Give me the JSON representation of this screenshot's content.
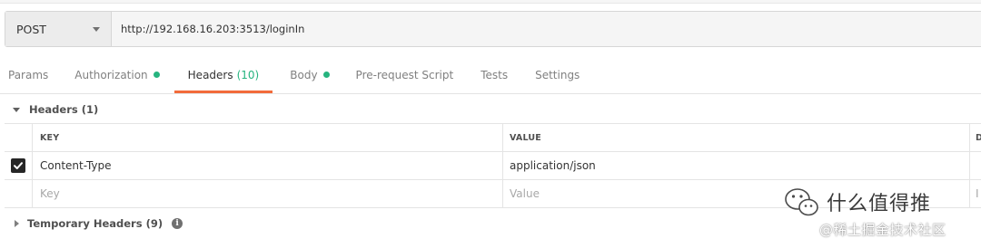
{
  "request": {
    "method": "POST",
    "url": "http://192.168.16.203:3513/loginIn"
  },
  "tabs": [
    {
      "label": "Params",
      "dot": false
    },
    {
      "label": "Authorization",
      "dot": true
    },
    {
      "label": "Headers",
      "count": "(10)",
      "active": true
    },
    {
      "label": "Body",
      "dot": true
    },
    {
      "label": "Pre-request Script",
      "dot": false
    },
    {
      "label": "Tests",
      "dot": false
    },
    {
      "label": "Settings",
      "dot": false
    }
  ],
  "headers_section": {
    "title": "Headers (1)",
    "columns": {
      "key": "KEY",
      "value": "VALUE",
      "desc": "D"
    },
    "rows": [
      {
        "checked": true,
        "key": "Content-Type",
        "value": "application/json"
      }
    ],
    "placeholder": {
      "key": "Key",
      "value": "Value",
      "desc": "I"
    }
  },
  "temporary_headers": {
    "title": "Temporary Headers (9)",
    "icon": "info-icon"
  },
  "watermark": {
    "line1": "什么值得推",
    "line2": "@稀土掘金技术社区"
  },
  "colors": {
    "accent": "#f26b3a",
    "status_dot": "#26b47f"
  }
}
